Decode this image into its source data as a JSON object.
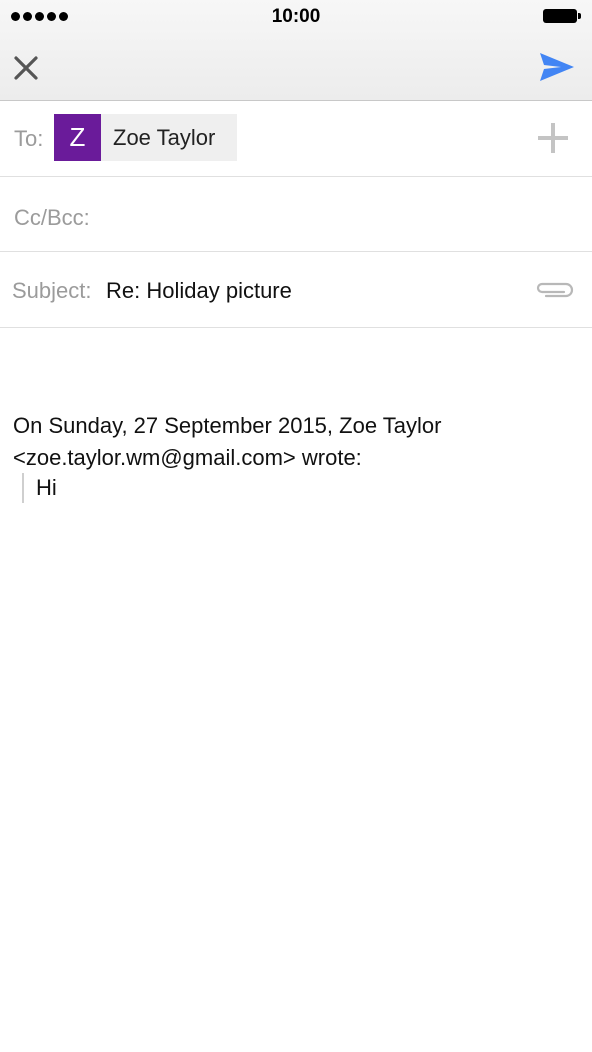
{
  "status_bar": {
    "time": "10:00"
  },
  "toolbar": {
    "close_icon": "close-icon",
    "send_icon": "send-icon",
    "accent_color": "#4285f4"
  },
  "compose": {
    "to_label": "To:",
    "recipient": {
      "initial": "Z",
      "name": "Zoe Taylor",
      "avatar_color": "#6a1b9a"
    },
    "cc_label": "Cc/Bcc:",
    "subject_label": "Subject:",
    "subject_value": "Re: Holiday picture",
    "quote_header_line1": "On Sunday, 27 September 2015, Zoe Taylor",
    "quote_header_line2": "<zoe.taylor.wm@gmail.com> wrote:",
    "quoted_text": "Hi"
  }
}
